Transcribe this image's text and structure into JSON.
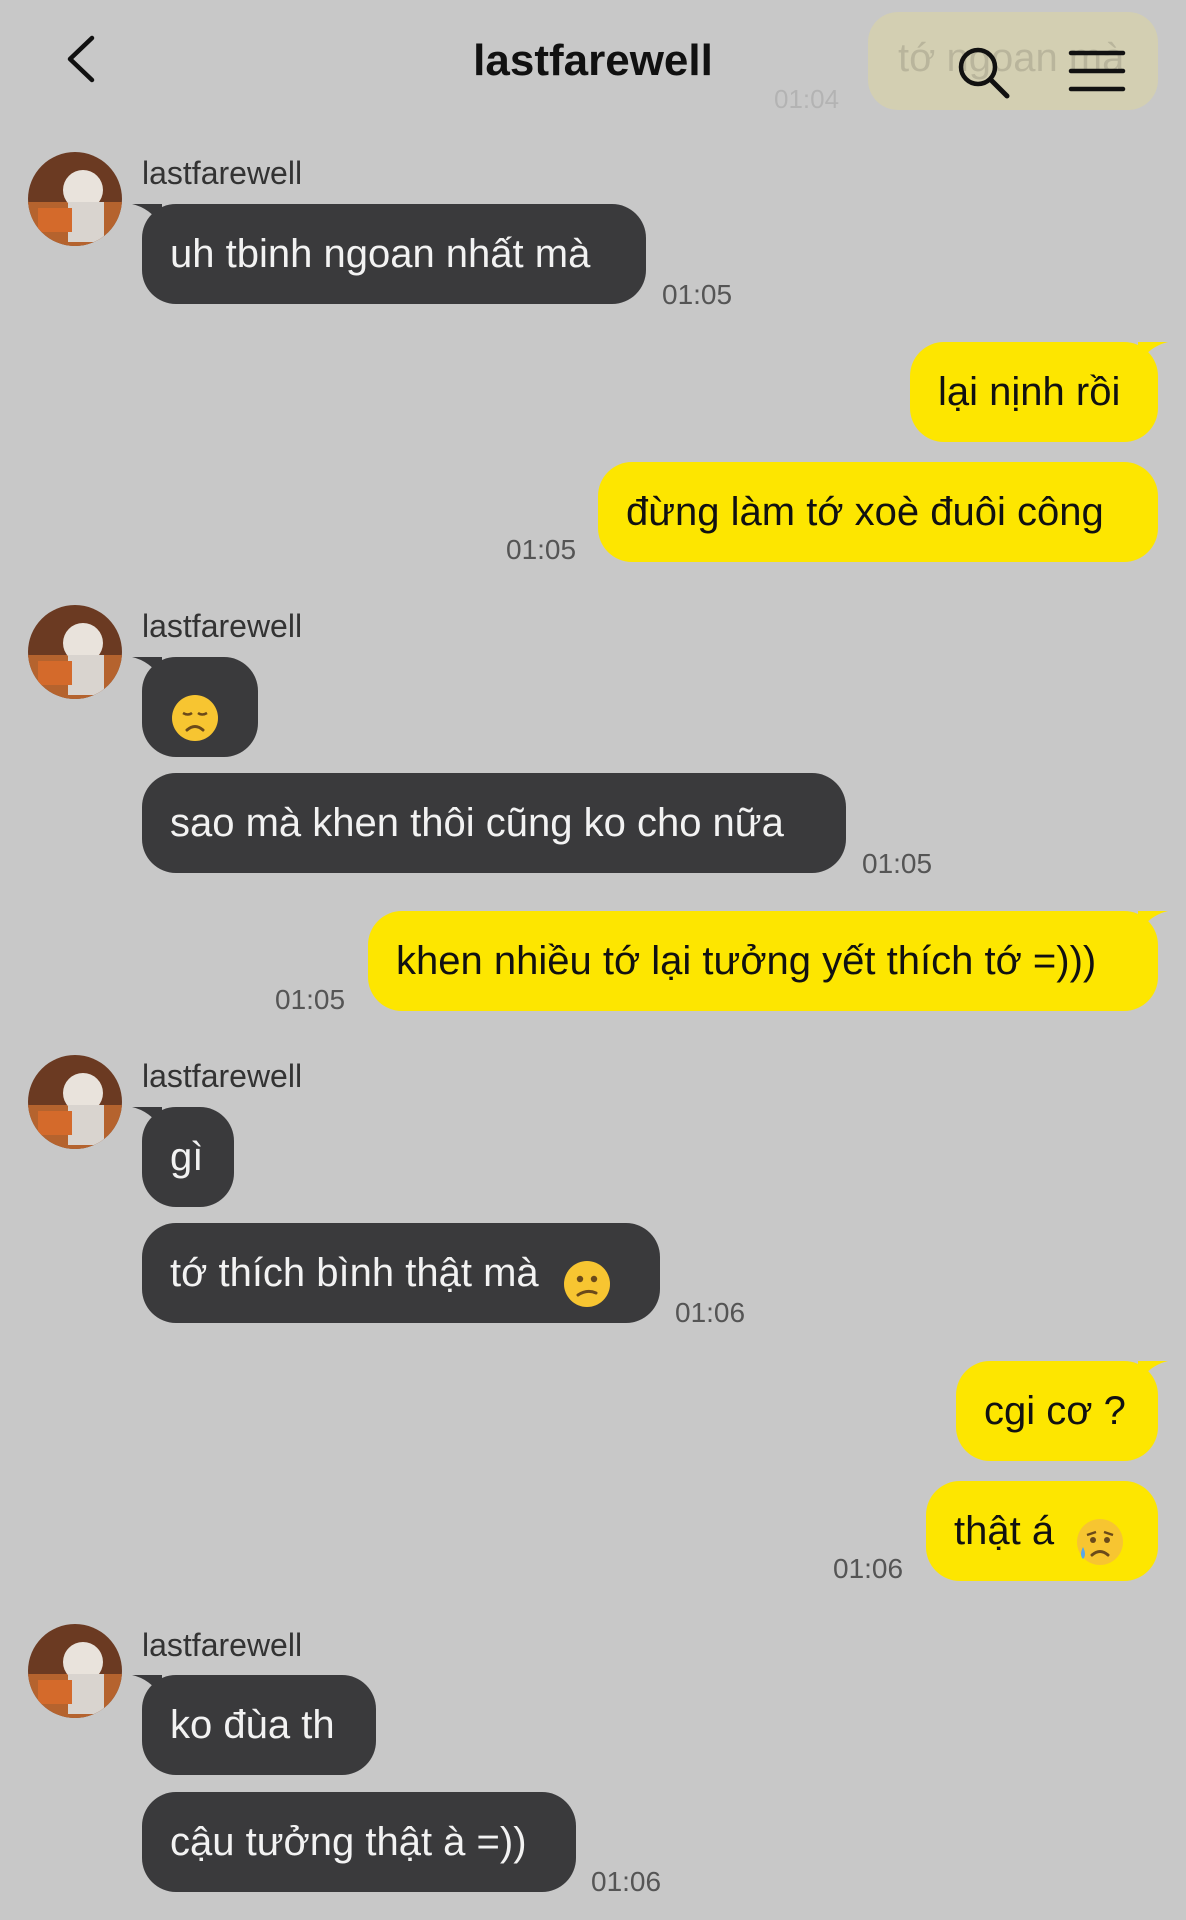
{
  "header": {
    "title": "lastfarewell"
  },
  "ghost": {
    "text": "tớ ngoan mà",
    "time": "01:04"
  },
  "messages": [
    {
      "sender": "lastfarewell",
      "text": "uh tbinh ngoan nhất mà",
      "time": "01:05"
    },
    {
      "text": "lại nịnh rồi"
    },
    {
      "text": "đừng làm tớ xoè đuôi công",
      "time": "01:05"
    },
    {
      "sender": "lastfarewell",
      "emoji": "disappointed-face"
    },
    {
      "text": "sao mà khen thôi cũng ko cho nữa",
      "time": "01:05"
    },
    {
      "text": "khen nhiều tớ lại tưởng yết thích tớ =)))",
      "time": "01:05"
    },
    {
      "sender": "lastfarewell",
      "text": "gì"
    },
    {
      "text": "tớ thích bình thật mà",
      "emoji": "confused-face",
      "time": "01:06"
    },
    {
      "text": "cgi cơ ?"
    },
    {
      "text": "thật á",
      "emoji": "sad-relieved-face",
      "time": "01:06"
    },
    {
      "sender": "lastfarewell",
      "text": "ko đùa th"
    },
    {
      "text": "cậu tưởng thật à =))",
      "time": "01:06"
    }
  ]
}
